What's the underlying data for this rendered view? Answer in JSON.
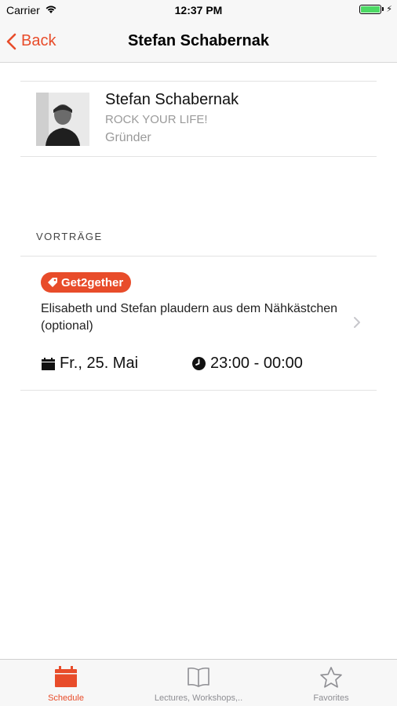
{
  "status_bar": {
    "carrier": "Carrier",
    "time": "12:37 PM",
    "battery_level": 1.0,
    "battery_color": "#4cd964"
  },
  "nav": {
    "back_label": "Back",
    "title": "Stefan Schabernak",
    "accent": "#e84c2a"
  },
  "speaker": {
    "name": "Stefan Schabernak",
    "organization": "ROCK YOUR LIFE!",
    "role": "Gründer"
  },
  "lectures_section": {
    "header": "VORTRÄGE",
    "items": [
      {
        "tag": "Get2gether",
        "tag_icon": "tag-icon",
        "title": "Elisabeth und Stefan plaudern aus dem Nähkästchen (optional)",
        "date": "Fr., 25. Mai",
        "date_icon": "calendar-icon",
        "time": "23:00 - 00:00",
        "time_icon": "clock-icon"
      }
    ]
  },
  "tab_bar": {
    "tabs": [
      {
        "label": "Schedule",
        "icon": "calendar-icon",
        "active": true
      },
      {
        "label": "Lectures, Workshops,..",
        "icon": "book-icon",
        "active": false
      },
      {
        "label": "Favorites",
        "icon": "star-icon",
        "active": false
      }
    ]
  }
}
